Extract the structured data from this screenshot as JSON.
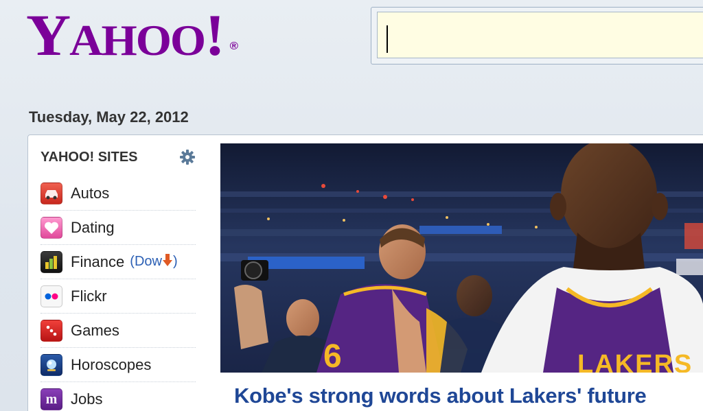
{
  "brand": {
    "logo_text": "YAHOO!",
    "brand_color": "#7b0099"
  },
  "search": {
    "value": "",
    "placeholder": ""
  },
  "date_text": "Tuesday, May 22, 2012",
  "sites": {
    "title": "YAHOO! SITES",
    "settings_icon": "gear-icon",
    "items": [
      {
        "label": "Autos",
        "icon": "car-icon"
      },
      {
        "label": "Dating",
        "icon": "heart-icon"
      },
      {
        "label": "Finance",
        "icon": "finance-icon",
        "extra": "(Dow",
        "extra_icon": "down-arrow-icon"
      },
      {
        "label": "Flickr",
        "icon": "flickr-icon"
      },
      {
        "label": "Games",
        "icon": "dice-icon"
      },
      {
        "label": "Horoscopes",
        "icon": "crystal-ball-icon"
      },
      {
        "label": "Jobs",
        "icon": "jobs-icon"
      }
    ]
  },
  "feature": {
    "headline": "Kobe's strong words about Lakers' future",
    "jersey_text": "LAKERS",
    "jersey_number": "6",
    "accent_color": "#552583",
    "gold_color": "#f5b926"
  }
}
